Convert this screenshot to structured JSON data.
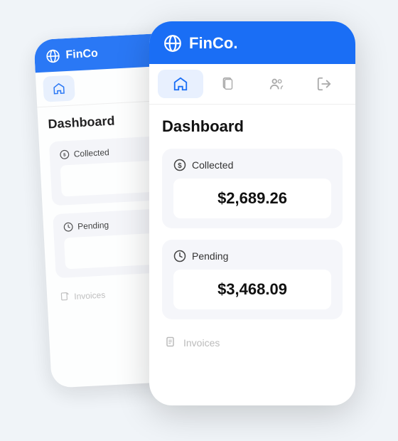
{
  "app": {
    "name": "FinCo.",
    "brand_color": "#1a6ef5"
  },
  "back_phone": {
    "header_text": "FinCo",
    "page_title": "Dashboard",
    "nav_items": [
      "home",
      "documents",
      "users",
      "logout"
    ],
    "cards": [
      {
        "label": "Collected",
        "icon": "dollar-circle"
      },
      {
        "label": "Pending",
        "icon": "clock"
      }
    ],
    "invoices_label": "Invoices"
  },
  "front_phone": {
    "page_title": "Dashboard",
    "cards": [
      {
        "label": "Collected",
        "icon": "dollar-circle",
        "value": "$2,689.26"
      },
      {
        "label": "Pending",
        "icon": "clock",
        "value": "$3,468.09"
      }
    ],
    "invoices_label": "Invoices"
  }
}
